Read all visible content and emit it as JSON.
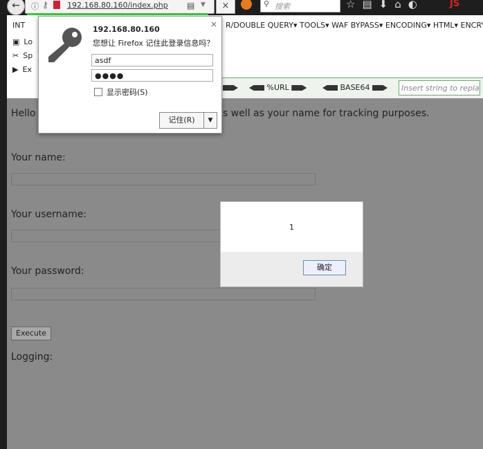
{
  "browser": {
    "url": "192.168.80.160/index.php",
    "search_placeholder": "搜索",
    "js_label": "JS"
  },
  "hackbar": {
    "int_label": "INT",
    "menu": "R/DOUBLE QUERY▾  TOOLS▾  WAF BYPASS▾  ENCODING▾  HTML▾  ENCRY",
    "enc_url": "%URL",
    "enc_base64": "BASE64",
    "replace_placeholder": "Insert string to replace"
  },
  "sidebar": {
    "items": [
      {
        "label": "Lo"
      },
      {
        "label": "Sp"
      },
      {
        "label": "Ex"
      }
    ]
  },
  "page": {
    "hello": "Hello",
    "hello_tail": "s well as your name for tracking purposes.",
    "name_label": "Your name:",
    "username_label": "Your username:",
    "password_label": "Your password:",
    "execute_label": "Execute",
    "logging_label": "Logging:"
  },
  "alert": {
    "message": "1",
    "ok_label": "确定"
  },
  "password_prompt": {
    "host": "192.168.80.160",
    "question": "您想让 Firefox 记住此登录信息吗？",
    "username": "asdf",
    "password_mask": "●●●●",
    "show_password": "显示密码(S)",
    "save_label": "记住(R)",
    "close": "×"
  }
}
